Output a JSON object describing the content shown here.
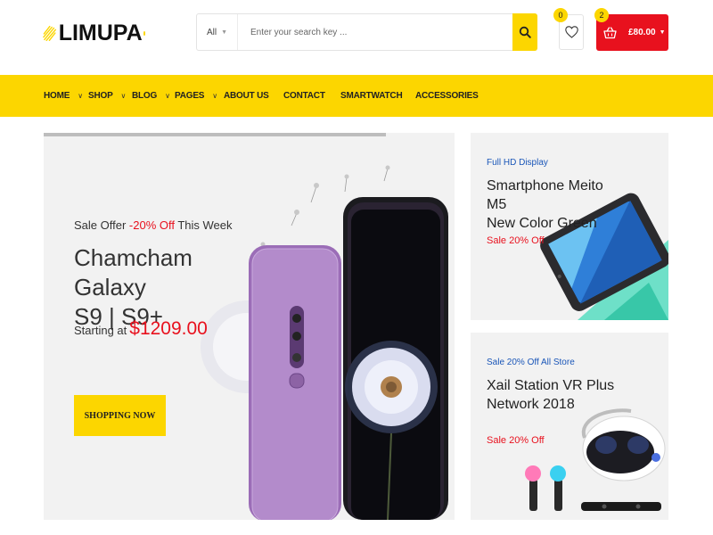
{
  "brand": {
    "name": "LIMUPA"
  },
  "search": {
    "category": "All",
    "placeholder": "Enter your search key ..."
  },
  "wishlist": {
    "count": "0"
  },
  "cart": {
    "count": "2",
    "total": "£80.00"
  },
  "nav": {
    "items": [
      {
        "label": "HOME",
        "dropdown": true
      },
      {
        "label": "SHOP",
        "dropdown": true
      },
      {
        "label": "BLOG",
        "dropdown": true
      },
      {
        "label": "PAGES",
        "dropdown": true
      },
      {
        "label": "ABOUT US",
        "dropdown": false
      },
      {
        "label": "CONTACT",
        "dropdown": false
      },
      {
        "label": "SMARTWATCH",
        "dropdown": false
      },
      {
        "label": "ACCESSORIES",
        "dropdown": false
      }
    ]
  },
  "hero": {
    "offer_prefix": "Sale Offer ",
    "offer_pct": "-20% Off",
    "offer_suffix": " This Week",
    "title_line1": "Chamcham Galaxy",
    "title_line2": "S9 | S9+",
    "price_prefix": "Starting at",
    "price": "$1209.00",
    "cta": "SHOPPING NOW"
  },
  "promos": [
    {
      "tag": "Full HD Display",
      "title_line1": "Smartphone Meito M5",
      "title_line2": "New Color Green",
      "sale": "Sale 20% Off"
    },
    {
      "tag": "Sale 20% Off All Store",
      "title_line1": "Xail Station VR Plus",
      "title_line2": "Network 2018",
      "sale": "Sale 20% Off"
    }
  ],
  "colors": {
    "accent": "#fcd600",
    "sale_red": "#e8111e",
    "tag_blue": "#1a56b8",
    "panel_bg": "#f2f2f2"
  },
  "icons": {
    "logo": "lightning-scribble-icon",
    "search": "magnifier-icon",
    "wishlist": "heart-icon",
    "cart": "shopping-basket-icon",
    "dropdown": "chevron-down-icon"
  }
}
